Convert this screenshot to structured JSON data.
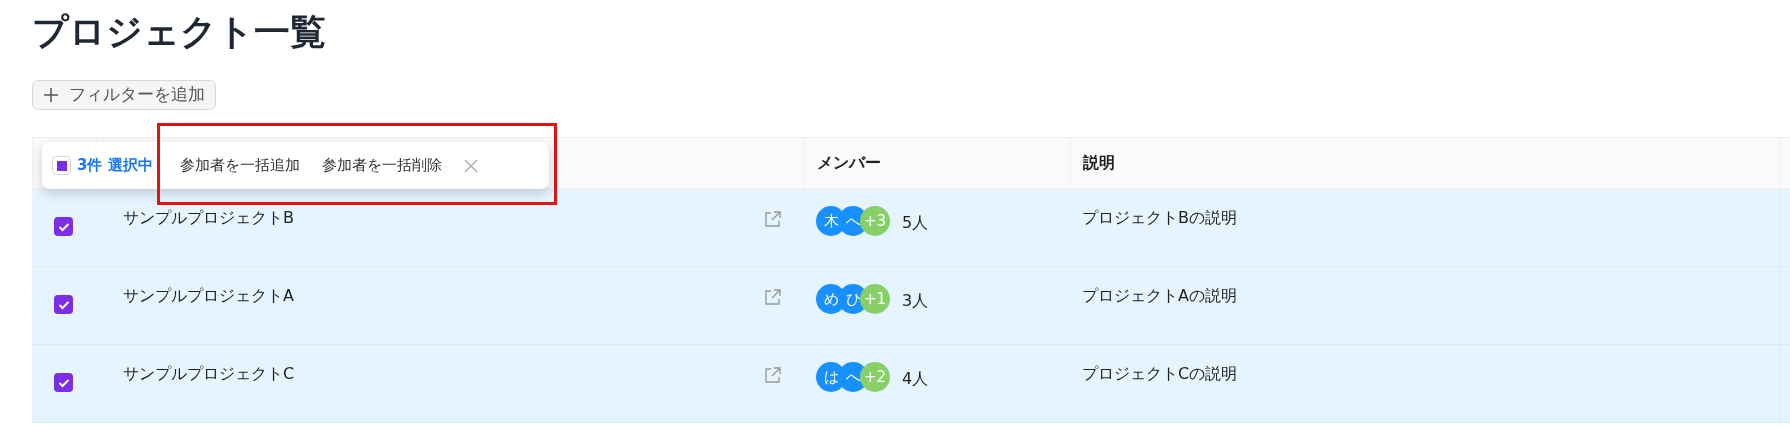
{
  "title": "プロジェクト一覧",
  "filter_button": {
    "label": "フィルターを追加"
  },
  "selection_bar": {
    "checked": true,
    "count": "3件",
    "label": "選択中",
    "actions": [
      "参加者を一括追加",
      "参加者を一括削除"
    ]
  },
  "table": {
    "columns": [
      {
        "label": "メンバー"
      },
      {
        "label": "説明"
      }
    ],
    "rows": [
      {
        "selected": true,
        "name": "サンプルプロジェクトB",
        "avatars": [
          {
            "text": "木",
            "color": "#1890ff"
          },
          {
            "text": "へ",
            "color": "#1890ff"
          },
          {
            "text": "+3",
            "color": "#87d068"
          }
        ],
        "member_count": "5人",
        "description": "プロジェクトBの説明"
      },
      {
        "selected": true,
        "name": "サンプルプロジェクトA",
        "avatars": [
          {
            "text": "め",
            "color": "#1890ff"
          },
          {
            "text": "ひ",
            "color": "#1890ff"
          },
          {
            "text": "+1",
            "color": "#87d068"
          }
        ],
        "member_count": "3人",
        "description": "プロジェクトAの説明"
      },
      {
        "selected": true,
        "name": "サンプルプロジェクトC",
        "avatars": [
          {
            "text": "は",
            "color": "#1890ff"
          },
          {
            "text": "へ",
            "color": "#1890ff"
          },
          {
            "text": "+2",
            "color": "#87d068"
          }
        ],
        "member_count": "4人",
        "description": "プロジェクトCの説明"
      }
    ]
  },
  "highlight_frame": true
}
